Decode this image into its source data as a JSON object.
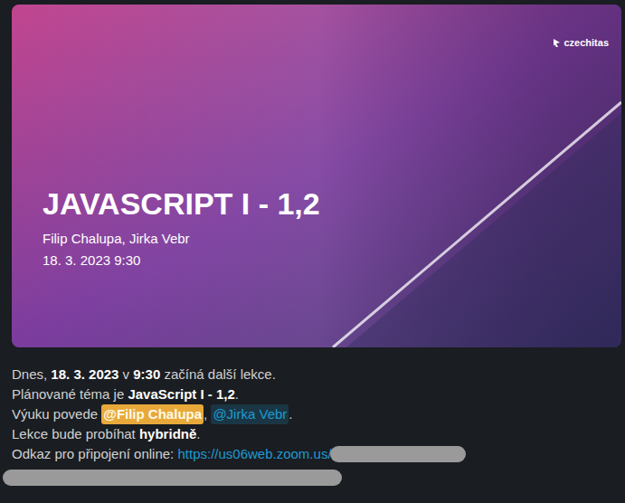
{
  "banner": {
    "logo": "czechitas",
    "title": "JAVASCRIPT I - 1,2",
    "authors": "Filip Chalupa, Jirka Vebr",
    "date": "18. 3. 2023 9:30"
  },
  "message": {
    "lines": [
      {
        "segments": [
          {
            "text": "Dnes, ",
            "kind": "plain"
          },
          {
            "text": "18. 3. 2023",
            "kind": "bold"
          },
          {
            "text": " v ",
            "kind": "plain"
          },
          {
            "text": "9:30",
            "kind": "bold"
          },
          {
            "text": " začíná další lekce.",
            "kind": "plain"
          }
        ]
      },
      {
        "segments": [
          {
            "text": "Plánované téma je ",
            "kind": "plain"
          },
          {
            "text": "JavaScript I - 1,2",
            "kind": "bold"
          },
          {
            "text": ".",
            "kind": "plain"
          }
        ]
      },
      {
        "segments": [
          {
            "text": "Výuku povede ",
            "kind": "plain"
          },
          {
            "text": "@Filip Chalupa",
            "kind": "selfmention"
          },
          {
            "text": ", ",
            "kind": "plain"
          },
          {
            "text": "@Jirka Vebr",
            "kind": "mention"
          },
          {
            "text": ".",
            "kind": "plain"
          }
        ]
      },
      {
        "segments": [
          {
            "text": "Lekce bude probíhat ",
            "kind": "plain"
          },
          {
            "text": "hybridně",
            "kind": "bold"
          },
          {
            "text": ".",
            "kind": "plain"
          }
        ]
      },
      {
        "segments": [
          {
            "text": "Odkaz pro připojení online: ",
            "kind": "plain"
          },
          {
            "text": "https://us06web.zoom.us/",
            "kind": "link"
          }
        ]
      }
    ]
  }
}
